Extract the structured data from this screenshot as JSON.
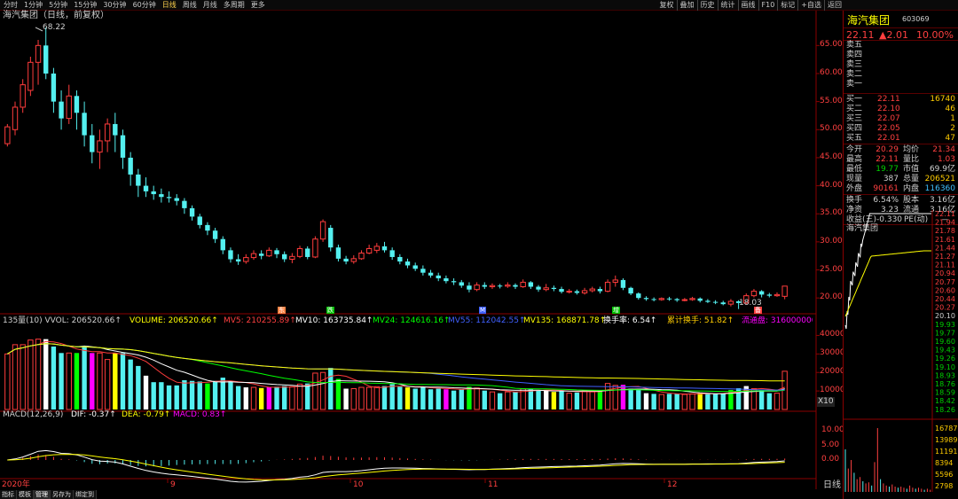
{
  "toolbar": {
    "periods": [
      "分时",
      "1分钟",
      "5分钟",
      "15分钟",
      "30分钟",
      "60分钟",
      "日线",
      "周线",
      "月线",
      "多周期",
      "更多"
    ],
    "active_period": "日线",
    "tools": [
      "复权",
      "叠加",
      "历史",
      "统计",
      "画线",
      "F10",
      "标记",
      "+自选",
      "返回"
    ]
  },
  "chart_header": {
    "title": "海汽集团（日线，前复权）",
    "max_label": "68.22",
    "min_label": "18.03"
  },
  "vol_header": {
    "prefix": "135量(10) VVOL: 206520.66↑",
    "volume": "VOLUME: 206520.66↑",
    "mv5": "MV5: 210255.89↑",
    "mv10": "MV10: 163735.84↑",
    "mv24": "MV24: 124616.16↑",
    "mv55": "MV55: 112042.55↑",
    "mv135": "MV135: 168871.78↑",
    "turnover": "换手率: 6.54↑",
    "cum_turnover": "累计换手: 51.82↑",
    "float": "流通盘: 316000000"
  },
  "macd_header": {
    "params": "MACD(12,26,9)",
    "dif": "DIF: -0.37↑",
    "dea": "DEA: -0.79↑",
    "macd": "MACD: 0.83↑"
  },
  "price_axis": [
    "65.00",
    "60.00",
    "55.00",
    "50.00",
    "45.00",
    "40.00",
    "35.00",
    "30.00",
    "25.00",
    "20.00"
  ],
  "vol_axis": [
    "40000",
    "30000",
    "20000",
    "10000"
  ],
  "vol_unit": "X10",
  "macd_axis": [
    "10.00",
    "5.00",
    "0.00"
  ],
  "dates": {
    "year": "2020年",
    "months": [
      "9",
      "10",
      "11",
      "12"
    ]
  },
  "bottom_tabs": [
    "指标",
    "模板",
    "管理",
    "另存为",
    "绑定到"
  ],
  "active_tab": "管理",
  "period_label": "日线",
  "markers": [
    "东",
    "跌",
    "M",
    "增",
    "备"
  ],
  "right_panel": {
    "name": "海汽集团",
    "code": "603069",
    "price": "22.11",
    "change": "▲2.01",
    "change_pct": "10.00%",
    "asks": [
      {
        "label": "卖五",
        "price": "",
        "vol": ""
      },
      {
        "label": "卖四",
        "price": "",
        "vol": ""
      },
      {
        "label": "卖三",
        "price": "",
        "vol": ""
      },
      {
        "label": "卖二",
        "price": "",
        "vol": ""
      },
      {
        "label": "卖一",
        "price": "",
        "vol": ""
      }
    ],
    "bids": [
      {
        "label": "买一",
        "price": "22.11",
        "vol": "16740"
      },
      {
        "label": "买二",
        "price": "22.10",
        "vol": "46"
      },
      {
        "label": "买三",
        "price": "22.07",
        "vol": "1"
      },
      {
        "label": "买四",
        "price": "22.05",
        "vol": "2"
      },
      {
        "label": "买五",
        "price": "22.01",
        "vol": "47"
      }
    ],
    "stats": [
      {
        "k1": "今开",
        "v1": "20.29",
        "k2": "均价",
        "v2": "21.34"
      },
      {
        "k1": "最高",
        "v1": "22.11",
        "k2": "量比",
        "v2": "1.03"
      },
      {
        "k1": "最低",
        "v1": "19.77",
        "k2": "市值",
        "v2": "69.9亿"
      },
      {
        "k1": "现量",
        "v1": "387",
        "k2": "总量",
        "v2": "206521"
      },
      {
        "k1": "外盘",
        "v1": "90161",
        "k2": "内盘",
        "v2": "116360"
      }
    ],
    "stats2": [
      {
        "k1": "换手",
        "v1": "6.54%",
        "k2": "股本",
        "v2": "3.16亿"
      },
      {
        "k1": "净资",
        "v1": "3.23",
        "k2": "流通",
        "v2": "3.16亿"
      }
    ],
    "eps": "收益(三)-0.330",
    "pe": "PE(动)",
    "pe_val": "—",
    "mini_title": "海汽集团",
    "mini_axis": [
      "22.11",
      "21.94",
      "21.78",
      "21.61",
      "21.44",
      "21.27",
      "21.11",
      "20.94",
      "20.77",
      "20.60",
      "20.44",
      "20.27",
      "20.10",
      "19.93",
      "19.77",
      "19.60",
      "19.43",
      "19.26",
      "19.10",
      "18.93",
      "18.76",
      "18.59",
      "18.42",
      "18.26"
    ],
    "mini_vol_axis": [
      "16787",
      "13989",
      "11191",
      "8394",
      "5596",
      "2798"
    ]
  },
  "colors": {
    "up": "#ff3c3c",
    "down": "#54f0f0",
    "mv5": "#ffffff",
    "mv10": "#ffff00",
    "mv24": "#ff00ff",
    "mv55": "#00ff00",
    "axis": "#8b0000"
  },
  "chart_data": {
    "type": "candlestick",
    "ylim": [
      17.5,
      69
    ],
    "candles": [
      [
        47.5,
        50.5,
        47,
        51
      ],
      [
        50,
        54,
        49,
        55
      ],
      [
        54,
        58,
        53,
        59
      ],
      [
        57,
        62,
        56,
        63
      ],
      [
        62,
        65,
        58,
        66
      ],
      [
        65,
        60,
        59,
        68.22
      ],
      [
        60,
        55,
        53,
        61
      ],
      [
        55,
        52,
        50,
        57
      ],
      [
        52,
        56,
        51,
        58
      ],
      [
        56,
        53,
        50,
        57
      ],
      [
        53,
        49,
        47,
        55
      ],
      [
        49,
        46,
        44,
        51
      ],
      [
        46,
        48,
        43,
        50
      ],
      [
        48,
        51,
        46,
        52
      ],
      [
        51,
        49,
        46,
        53
      ],
      [
        49,
        45,
        43,
        50
      ],
      [
        45,
        42,
        40,
        46
      ],
      [
        42,
        40,
        38,
        43
      ],
      [
        40,
        39,
        38,
        41.5
      ],
      [
        39,
        38.5,
        37.5,
        40
      ],
      [
        38.5,
        38,
        37,
        39.5
      ],
      [
        38,
        37.8,
        37,
        39
      ],
      [
        37.8,
        37.3,
        36.5,
        38.5
      ],
      [
        37.3,
        36,
        35,
        37.8
      ],
      [
        36,
        34.5,
        33.8,
        36.5
      ],
      [
        34.5,
        33,
        32.4,
        35
      ],
      [
        33,
        32,
        31.2,
        33.5
      ],
      [
        32,
        30.5,
        29.8,
        32.5
      ],
      [
        30.5,
        28.5,
        27.8,
        31
      ],
      [
        28.5,
        26.9,
        26.3,
        29
      ],
      [
        26.9,
        26.5,
        25.9,
        27.8
      ],
      [
        26.5,
        27.2,
        26.1,
        27.8
      ],
      [
        27.2,
        27.9,
        26.8,
        28.5
      ],
      [
        27.9,
        27.5,
        26.9,
        28.5
      ],
      [
        27.5,
        28.5,
        27.3,
        29
      ],
      [
        28.5,
        27.8,
        27.1,
        28.9
      ],
      [
        27.8,
        26.9,
        26.4,
        28.3
      ],
      [
        26.9,
        27.4,
        26.2,
        28
      ],
      [
        27.4,
        28.8,
        27.1,
        29.3
      ],
      [
        28.8,
        27.3,
        26.9,
        29.2
      ],
      [
        27.3,
        30.5,
        27.1,
        31
      ],
      [
        30.5,
        33.6,
        30,
        34
      ],
      [
        32.5,
        29,
        28.3,
        33
      ],
      [
        29,
        27,
        26.5,
        29.5
      ],
      [
        27,
        26.5,
        26,
        27.5
      ],
      [
        26.5,
        27,
        26.1,
        27.6
      ],
      [
        27,
        28,
        26.8,
        28.5
      ],
      [
        28,
        28.8,
        27.8,
        29.5
      ],
      [
        28.5,
        29.2,
        28,
        29.8
      ],
      [
        29.2,
        28.5,
        28.1,
        30
      ],
      [
        28.5,
        27.3,
        26.8,
        29
      ],
      [
        27.3,
        26.5,
        26,
        27.8
      ],
      [
        26.5,
        25.8,
        25.3,
        27
      ],
      [
        25.8,
        25.2,
        24.8,
        26.3
      ],
      [
        25.2,
        24.5,
        24,
        25.8
      ],
      [
        24.5,
        24,
        23.6,
        25
      ],
      [
        24,
        23.5,
        23,
        24.5
      ],
      [
        23.5,
        23,
        22.6,
        24
      ],
      [
        23,
        22.8,
        22.3,
        23.5
      ],
      [
        22.8,
        22.2,
        21.8,
        23.2
      ],
      [
        22.2,
        21.5,
        21,
        22.8
      ],
      [
        21.5,
        22.3,
        21.2,
        22.8
      ],
      [
        22.3,
        22,
        21.6,
        22.8
      ],
      [
        22,
        22.2,
        21.6,
        22.6
      ],
      [
        22.2,
        22.1,
        21.7,
        22.5
      ],
      [
        22.1,
        22.3,
        21.8,
        22.8
      ],
      [
        22.3,
        22,
        21.6,
        22.6
      ],
      [
        22,
        22.8,
        21.8,
        23.3
      ],
      [
        22.8,
        22,
        21.6,
        23
      ],
      [
        22,
        21.5,
        21.1,
        22.3
      ],
      [
        21.5,
        21.8,
        21.2,
        22.5
      ],
      [
        21.8,
        21.6,
        21.2,
        22.2
      ],
      [
        21.6,
        21.1,
        20.8,
        22
      ],
      [
        21.1,
        21.2,
        20.8,
        21.6
      ],
      [
        21.2,
        20.9,
        20.6,
        21.5
      ],
      [
        20.9,
        21.3,
        20.6,
        21.8
      ],
      [
        21.3,
        21.6,
        21,
        22
      ],
      [
        21.6,
        21.2,
        20.8,
        22
      ],
      [
        21.2,
        22.8,
        21,
        23.3
      ],
      [
        22.8,
        23.2,
        22,
        24
      ],
      [
        23.2,
        21.8,
        21.4,
        23.5
      ],
      [
        21.8,
        20.8,
        20.5,
        22
      ],
      [
        20.8,
        20,
        19.7,
        21
      ],
      [
        20,
        19.8,
        19.5,
        20.3
      ],
      [
        19.8,
        19.7,
        19.4,
        20.1
      ],
      [
        19.7,
        19.9,
        19.5,
        20.1
      ],
      [
        19.9,
        19.8,
        19.5,
        20.2
      ],
      [
        19.8,
        19.6,
        19.3,
        20
      ],
      [
        19.6,
        19.7,
        19.4,
        20
      ],
      [
        19.7,
        19.9,
        19.5,
        20.2
      ],
      [
        19.9,
        19.5,
        19.2,
        20.1
      ],
      [
        19.5,
        19.3,
        19.1,
        19.8
      ],
      [
        19.3,
        19.2,
        18.9,
        19.6
      ],
      [
        19.2,
        18.9,
        18.7,
        19.5
      ],
      [
        18.9,
        19.4,
        18.5,
        19.8
      ],
      [
        19.4,
        19.1,
        18.03,
        19.6
      ],
      [
        19.1,
        20.4,
        18.9,
        20.8
      ],
      [
        20.4,
        21.2,
        20.1,
        21.6
      ],
      [
        21.2,
        20.6,
        20.1,
        21.4
      ],
      [
        20.6,
        20.4,
        20.1,
        20.9
      ],
      [
        20.4,
        20.6,
        20.2,
        21
      ],
      [
        20.29,
        22.11,
        19.77,
        22.11
      ]
    ]
  }
}
